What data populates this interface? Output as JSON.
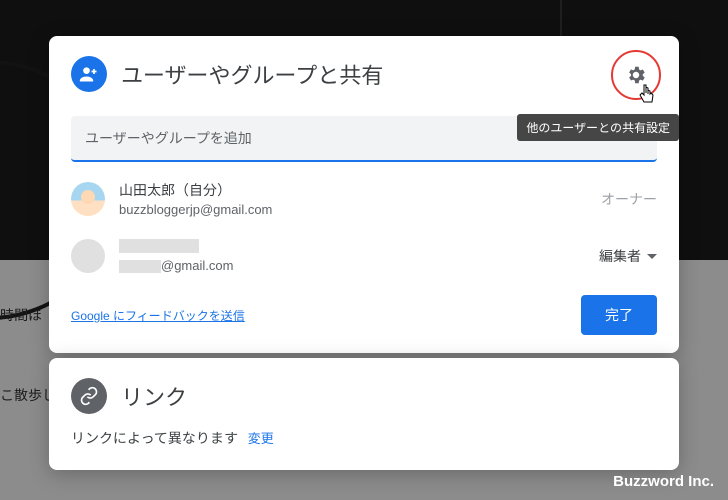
{
  "share": {
    "title": "ユーザーやグループと共有",
    "input_placeholder": "ユーザーやグループを追加",
    "tooltip": "他のユーザーとの共有設定",
    "people": [
      {
        "name": "山田太郎（自分）",
        "email": "buzzbloggerjp@gmail.com",
        "role": "オーナー"
      },
      {
        "name": "",
        "email_suffix": "@gmail.com",
        "role": "編集者"
      }
    ],
    "feedback_label": "Google にフィードバックを送信",
    "done_label": "完了"
  },
  "link": {
    "title": "リンク",
    "subtitle": "リンクによって異なります",
    "change_label": "変更"
  },
  "background": {
    "side_text_1": "時間ほ",
    "side_text_2": "こ散歩し"
  },
  "brand": "Buzzword Inc."
}
